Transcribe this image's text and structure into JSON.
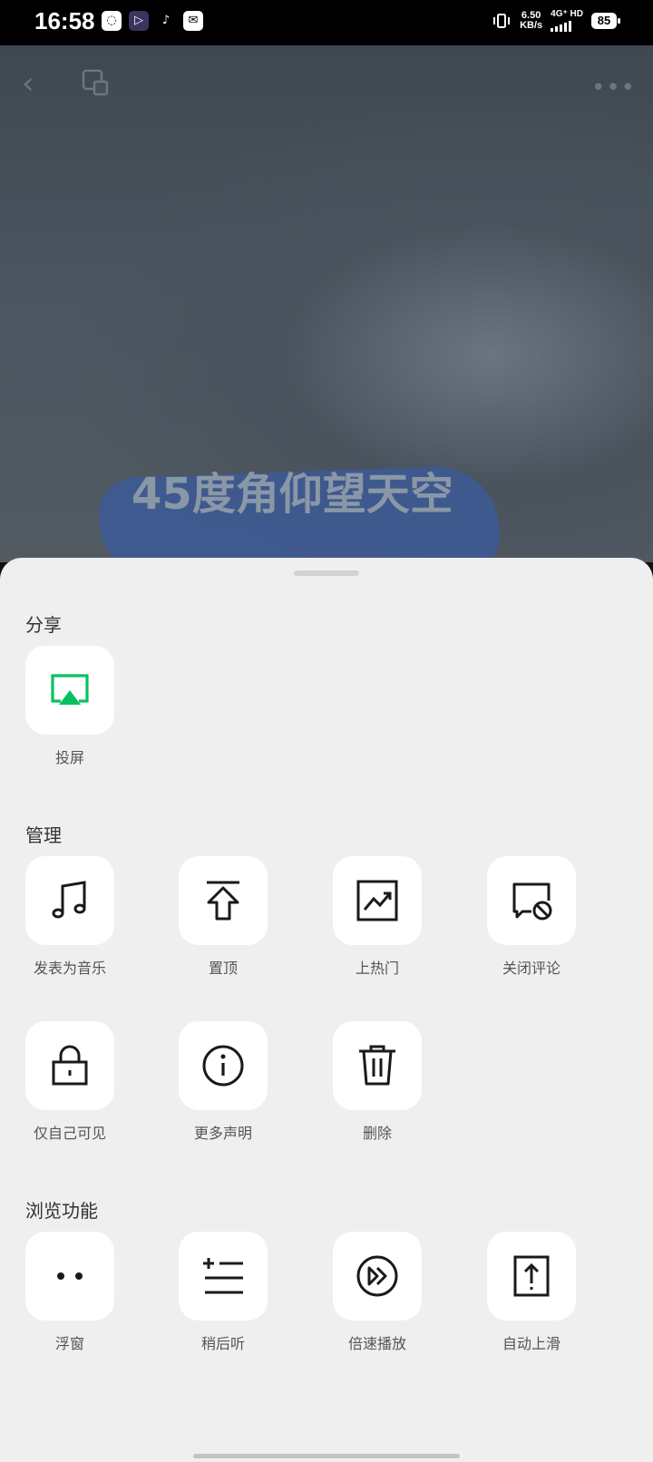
{
  "status_bar": {
    "time": "16:58",
    "net_speed": "6.50",
    "net_unit": "KB/s",
    "network_label": "4G⁺ HD",
    "battery": "85",
    "app_icons": [
      "cloud-app-icon",
      "video-app-icon",
      "tiktok-icon",
      "mail-icon"
    ]
  },
  "cover": {
    "title": "45度角仰望天空"
  },
  "sheet": {
    "sections": [
      {
        "title": "分享",
        "items": [
          {
            "label": "投屏",
            "icon": "airplay-icon"
          }
        ]
      },
      {
        "title": "管理",
        "items": [
          {
            "label": "发表为音乐",
            "icon": "music-note-icon"
          },
          {
            "label": "置顶",
            "icon": "pin-top-icon"
          },
          {
            "label": "上热门",
            "icon": "trending-icon"
          },
          {
            "label": "关闭评论",
            "icon": "comment-off-icon"
          },
          {
            "label": "仅自己可见",
            "icon": "lock-icon"
          },
          {
            "label": "更多声明",
            "icon": "info-icon"
          },
          {
            "label": "删除",
            "icon": "trash-icon"
          }
        ]
      },
      {
        "title": "浏览功能",
        "items": [
          {
            "label": "浮窗",
            "icon": "float-window-icon"
          },
          {
            "label": "稍后听",
            "icon": "listen-later-icon"
          },
          {
            "label": "倍速播放",
            "icon": "speed-icon"
          },
          {
            "label": "自动上滑",
            "icon": "auto-scroll-icon"
          }
        ]
      }
    ]
  },
  "colors": {
    "accent": "#07c160",
    "sheet_bg": "#efefef",
    "icon_stroke": "#1a1a1a"
  }
}
